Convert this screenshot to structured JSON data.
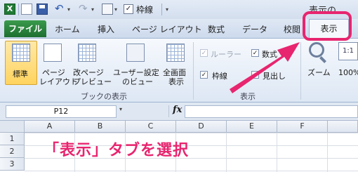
{
  "app": {
    "title_partial": "表示の"
  },
  "qat": {
    "gridlines_label": "枠線",
    "gridlines_checked": true
  },
  "tabs": [
    {
      "label": "ファイル"
    },
    {
      "label": "ホーム"
    },
    {
      "label": "挿入"
    },
    {
      "label": "ページ レイアウト"
    },
    {
      "label": "数式"
    },
    {
      "label": "データ"
    },
    {
      "label": "校閲"
    },
    {
      "label": "表示",
      "active": true
    }
  ],
  "ribbon": {
    "workbook_views": {
      "group_label": "ブックの表示",
      "buttons": [
        {
          "line1": "標準",
          "line2": "",
          "icon": "normal-view-icon",
          "selected": true
        },
        {
          "line1": "ページ",
          "line2": "レイアウト",
          "icon": "page-layout-icon"
        },
        {
          "line1": "改ページ",
          "line2": "プレビュー",
          "icon": "page-break-preview-icon"
        },
        {
          "line1": "ユーザー設定",
          "line2": "のビュー",
          "icon": "custom-views-icon"
        },
        {
          "line1": "全画面",
          "line2": "表示",
          "icon": "full-screen-icon"
        }
      ]
    },
    "show": {
      "group_label": "表示",
      "ruler": {
        "label": "ルーラー",
        "checked": true,
        "enabled": false
      },
      "formula_bar": {
        "label": "数式",
        "checked": true
      },
      "gridlines": {
        "label": "枠線",
        "checked": true
      },
      "headings": {
        "label": "見出し",
        "checked": true
      }
    },
    "zoom": {
      "zoom_label": "ズーム",
      "hundred_label": "100%"
    }
  },
  "formula_bar": {
    "name_box": "P12",
    "fx": "fx",
    "value": ""
  },
  "sheet": {
    "columns": [
      "A",
      "B",
      "C",
      "D",
      "E",
      "F"
    ],
    "rows": [
      "1",
      "2",
      "3"
    ]
  },
  "annotation": {
    "caption": "「表示」タブを選択",
    "color": "#e8256f"
  },
  "colors": {
    "file_tab": "#2b8a3e",
    "highlight": "#e8256f"
  }
}
